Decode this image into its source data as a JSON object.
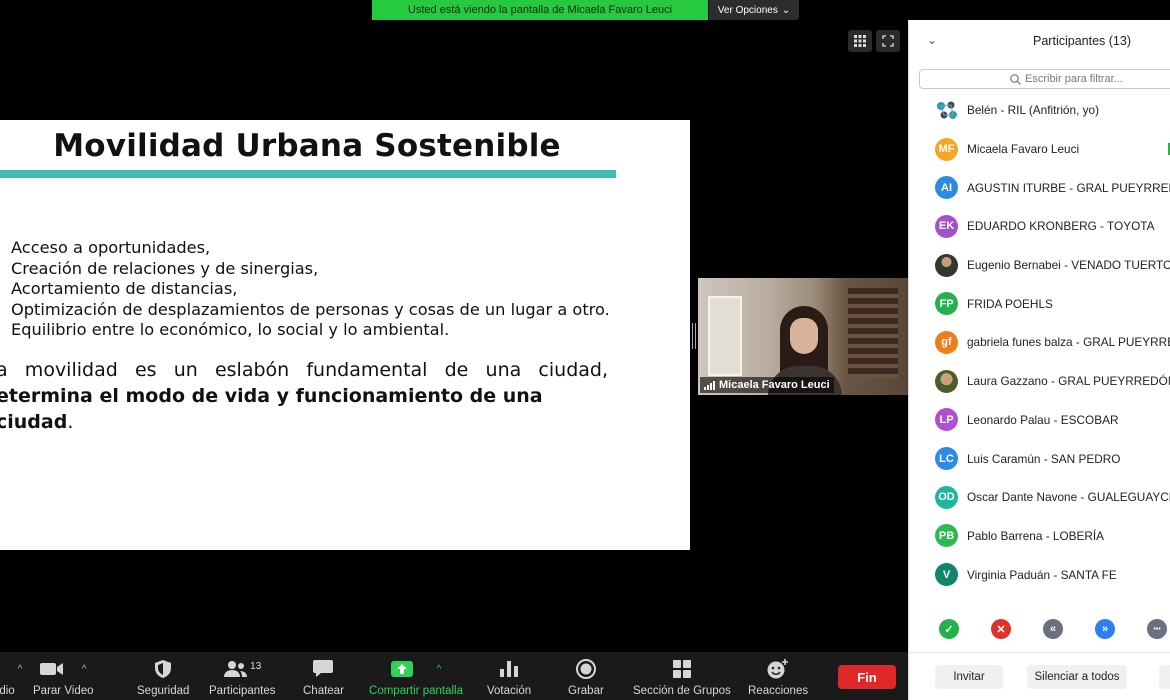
{
  "banner": {
    "sharing_text": "Usted está viendo la pantalla de Micaela Favaro Leuci",
    "view_options": "Ver Opciones"
  },
  "slide": {
    "title": "Movilidad Urbana Sostenible",
    "bullets": [
      "Acceso a oportunidades,",
      "Creación de relaciones y de sinergias,",
      "Acortamiento de distancias,",
      "Optimización de desplazamientos de personas y cosas de un lugar a otro.",
      "Equilibrio entre lo económico, lo social y lo ambiental."
    ],
    "statement_line1": "a movilidad es un eslabón fundamental de una ciudad,",
    "statement_line2": "etermina el modo de vida y funcionamiento de una ciudad",
    "statement_end": "."
  },
  "video": {
    "name": "Micaela Favaro Leuci"
  },
  "toolbar": {
    "audio_label": "dio",
    "video_label": "Parar Video",
    "security_label": "Seguridad",
    "participants_label": "Participantes",
    "participants_count": "13",
    "chat_label": "Chatear",
    "share_label": "Compartir pantalla",
    "poll_label": "Votación",
    "record_label": "Grabar",
    "breakout_label": "Sección de Grupos",
    "reactions_label": "Reacciones",
    "end_label": "Fin"
  },
  "panel": {
    "title": "Participantes (13)",
    "search_placeholder": "Escribir para filtrar...",
    "participants": [
      {
        "initials": "",
        "name": "Belén - RIL (Anfitrión, yo)",
        "color": "#ffffff",
        "kind": "logo"
      },
      {
        "initials": "MF",
        "name": "Micaela Favaro Leuci",
        "color": "#f5a623",
        "kind": "initials"
      },
      {
        "initials": "AI",
        "name": "AGUSTIN ITURBE - GRAL PUEYRREDÓN",
        "color": "#2d8ae5",
        "kind": "initials"
      },
      {
        "initials": "EK",
        "name": "EDUARDO KRONBERG - TOYOTA",
        "color": "#a44fcf",
        "kind": "initials"
      },
      {
        "initials": "",
        "name": "Eugenio Bernabei - VENADO TUERTO",
        "color": "#2e3a2f",
        "kind": "photo1"
      },
      {
        "initials": "FP",
        "name": "FRIDA POEHLS",
        "color": "#23b14d",
        "kind": "initials"
      },
      {
        "initials": "gf",
        "name": "gabriela funes balza - GRAL PUEYRREDÓN",
        "color": "#f07d1a",
        "kind": "initials"
      },
      {
        "initials": "",
        "name": "Laura Gazzano - GRAL PUEYRREDÓN",
        "color": "#4a5d2c",
        "kind": "photo2"
      },
      {
        "initials": "LP",
        "name": "Leonardo Palau - ESCOBAR",
        "color": "#b04fcf",
        "kind": "initials"
      },
      {
        "initials": "LC",
        "name": "Luis Caramún - SAN PEDRO",
        "color": "#2d8ae5",
        "kind": "initials"
      },
      {
        "initials": "OD",
        "name": "Oscar Dante Navone - GUALEGUAYCHÚ",
        "color": "#1fb6a0",
        "kind": "initials"
      },
      {
        "initials": "PB",
        "name": "Pablo Barrena - LOBERÍA",
        "color": "#2fb84f",
        "kind": "initials"
      },
      {
        "initials": "V",
        "name": "Virginia Paduán - SANTA FE",
        "color": "#10866a",
        "kind": "initials"
      }
    ],
    "reactions": [
      {
        "icon": "check-icon",
        "glyph": "✓",
        "color": "#23b14d"
      },
      {
        "icon": "x-icon",
        "glyph": "✕",
        "color": "#e0312c"
      },
      {
        "icon": "rewind-icon",
        "glyph": "«",
        "color": "#6b6f80"
      },
      {
        "icon": "fast-forward-icon",
        "glyph": "»",
        "color": "#2d7ef0"
      },
      {
        "icon": "more-icon",
        "glyph": "•••",
        "color": "#6b6f80"
      }
    ],
    "invite_label": "Invitar",
    "mute_all_label": "Silenciar a todos"
  }
}
